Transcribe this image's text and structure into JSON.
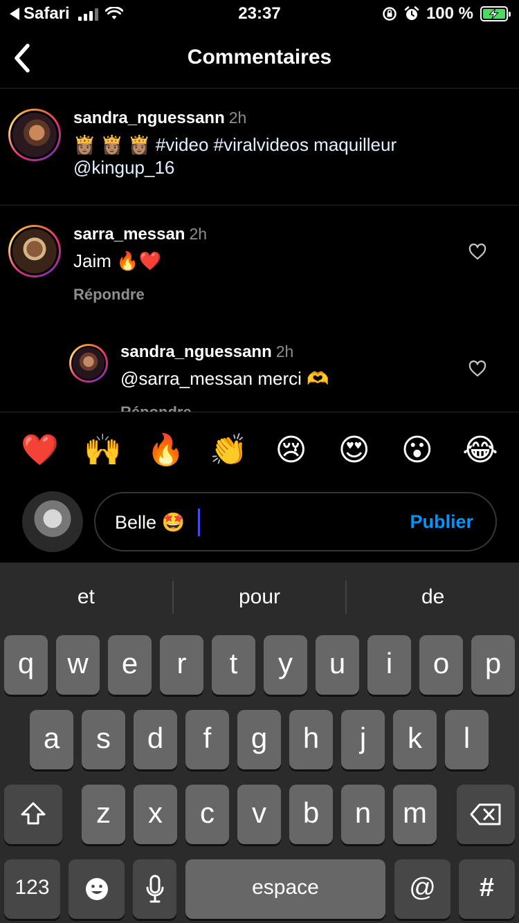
{
  "status_bar": {
    "back_app": "Safari",
    "time": "23:37",
    "battery": "100 %",
    "icons": [
      "signal-icon",
      "wifi-icon",
      "orientation-lock-icon",
      "alarm-icon",
      "battery-charging-icon"
    ]
  },
  "header": {
    "title": "Commentaires",
    "back_icon": "chevron-left-icon"
  },
  "caption": {
    "username": "sandra_nguessann",
    "time": "2h",
    "emojis": "👸🏽 👸🏽 👸🏽",
    "text": "#video #viralvideos maquilleur",
    "mention": "@kingup_16"
  },
  "comments": [
    {
      "username": "sarra_messan",
      "time": "2h",
      "text": "Jaim 🔥❤️",
      "reply_label": "Répondre"
    },
    {
      "username": "sandra_nguessann",
      "time": "2h",
      "text": "@sarra_messan merci 🫶",
      "reply_label": "Répondre"
    }
  ],
  "emoji_bar": [
    "❤️",
    "🙌",
    "🔥",
    "👏",
    "😢",
    "😍",
    "😮",
    "😂"
  ],
  "composer": {
    "value": "Belle 🤩",
    "publish_label": "Publier"
  },
  "keyboard": {
    "suggestions": [
      "et",
      "pour",
      "de"
    ],
    "row1": [
      "q",
      "w",
      "e",
      "r",
      "t",
      "y",
      "u",
      "i",
      "o",
      "p"
    ],
    "row2": [
      "a",
      "s",
      "d",
      "f",
      "g",
      "h",
      "j",
      "k",
      "l"
    ],
    "row3": [
      "z",
      "x",
      "c",
      "v",
      "b",
      "n",
      "m"
    ],
    "numbers_label": "123",
    "space_label": "espace",
    "at_label": "@",
    "hash_label": "#",
    "icons": [
      "shift-icon",
      "backspace-icon",
      "emoji-icon",
      "microphone-icon"
    ]
  }
}
